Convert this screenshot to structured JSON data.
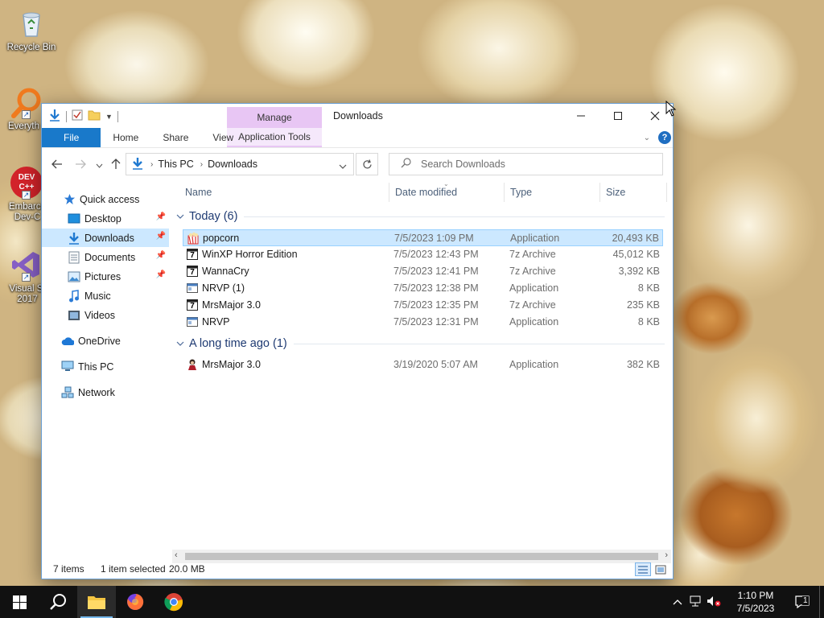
{
  "desktop": {
    "icons": [
      {
        "label": "Recycle Bin"
      },
      {
        "label": "Everyth"
      },
      {
        "label": "Embarca Dev-C"
      },
      {
        "label": "Visual St 2017"
      }
    ],
    "devcpp_badge": "DEV C++"
  },
  "window": {
    "title": "Downloads",
    "context_tab": "Manage",
    "context_subtab": "Application Tools",
    "ribbon_tabs": [
      "File",
      "Home",
      "Share",
      "View"
    ],
    "help_label": "?"
  },
  "address": {
    "crumbs": [
      "This PC",
      "Downloads"
    ],
    "search_placeholder": "Search Downloads"
  },
  "nav": {
    "items": [
      {
        "label": "Quick access"
      },
      {
        "label": "Desktop"
      },
      {
        "label": "Downloads"
      },
      {
        "label": "Documents"
      },
      {
        "label": "Pictures"
      },
      {
        "label": "Music"
      },
      {
        "label": "Videos"
      },
      {
        "label": "OneDrive"
      },
      {
        "label": "This PC"
      },
      {
        "label": "Network"
      }
    ]
  },
  "columns": {
    "name": "Name",
    "date": "Date modified",
    "type": "Type",
    "size": "Size"
  },
  "groups": [
    {
      "label": "Today (6)"
    },
    {
      "label": "A long time ago (1)"
    }
  ],
  "files": [
    {
      "name": "popcorn",
      "date": "7/5/2023 1:09 PM",
      "type": "Application",
      "size": "20,493 KB"
    },
    {
      "name": "WinXP Horror Edition",
      "date": "7/5/2023 12:43 PM",
      "type": "7z Archive",
      "size": "45,012 KB"
    },
    {
      "name": "WannaCry",
      "date": "7/5/2023 12:41 PM",
      "type": "7z Archive",
      "size": "3,392 KB"
    },
    {
      "name": "NRVP (1)",
      "date": "7/5/2023 12:38 PM",
      "type": "Application",
      "size": "8 KB"
    },
    {
      "name": "MrsMajor 3.0",
      "date": "7/5/2023 12:35 PM",
      "type": "7z Archive",
      "size": "235 KB"
    },
    {
      "name": "NRVP",
      "date": "7/5/2023 12:31 PM",
      "type": "Application",
      "size": "8 KB"
    },
    {
      "name": "MrsMajor 3.0",
      "date": "3/19/2020 5:07 AM",
      "type": "Application",
      "size": "382 KB"
    }
  ],
  "status": {
    "items": "7 items",
    "selected": "1 item selected",
    "size": "20.0 MB"
  },
  "taskbar": {
    "time": "1:10 PM",
    "date": "7/5/2023",
    "notification_count": "1"
  },
  "colors": {
    "accent": "#1979ca",
    "selection": "#cce8ff",
    "manage_tab": "#e8c6f4"
  }
}
